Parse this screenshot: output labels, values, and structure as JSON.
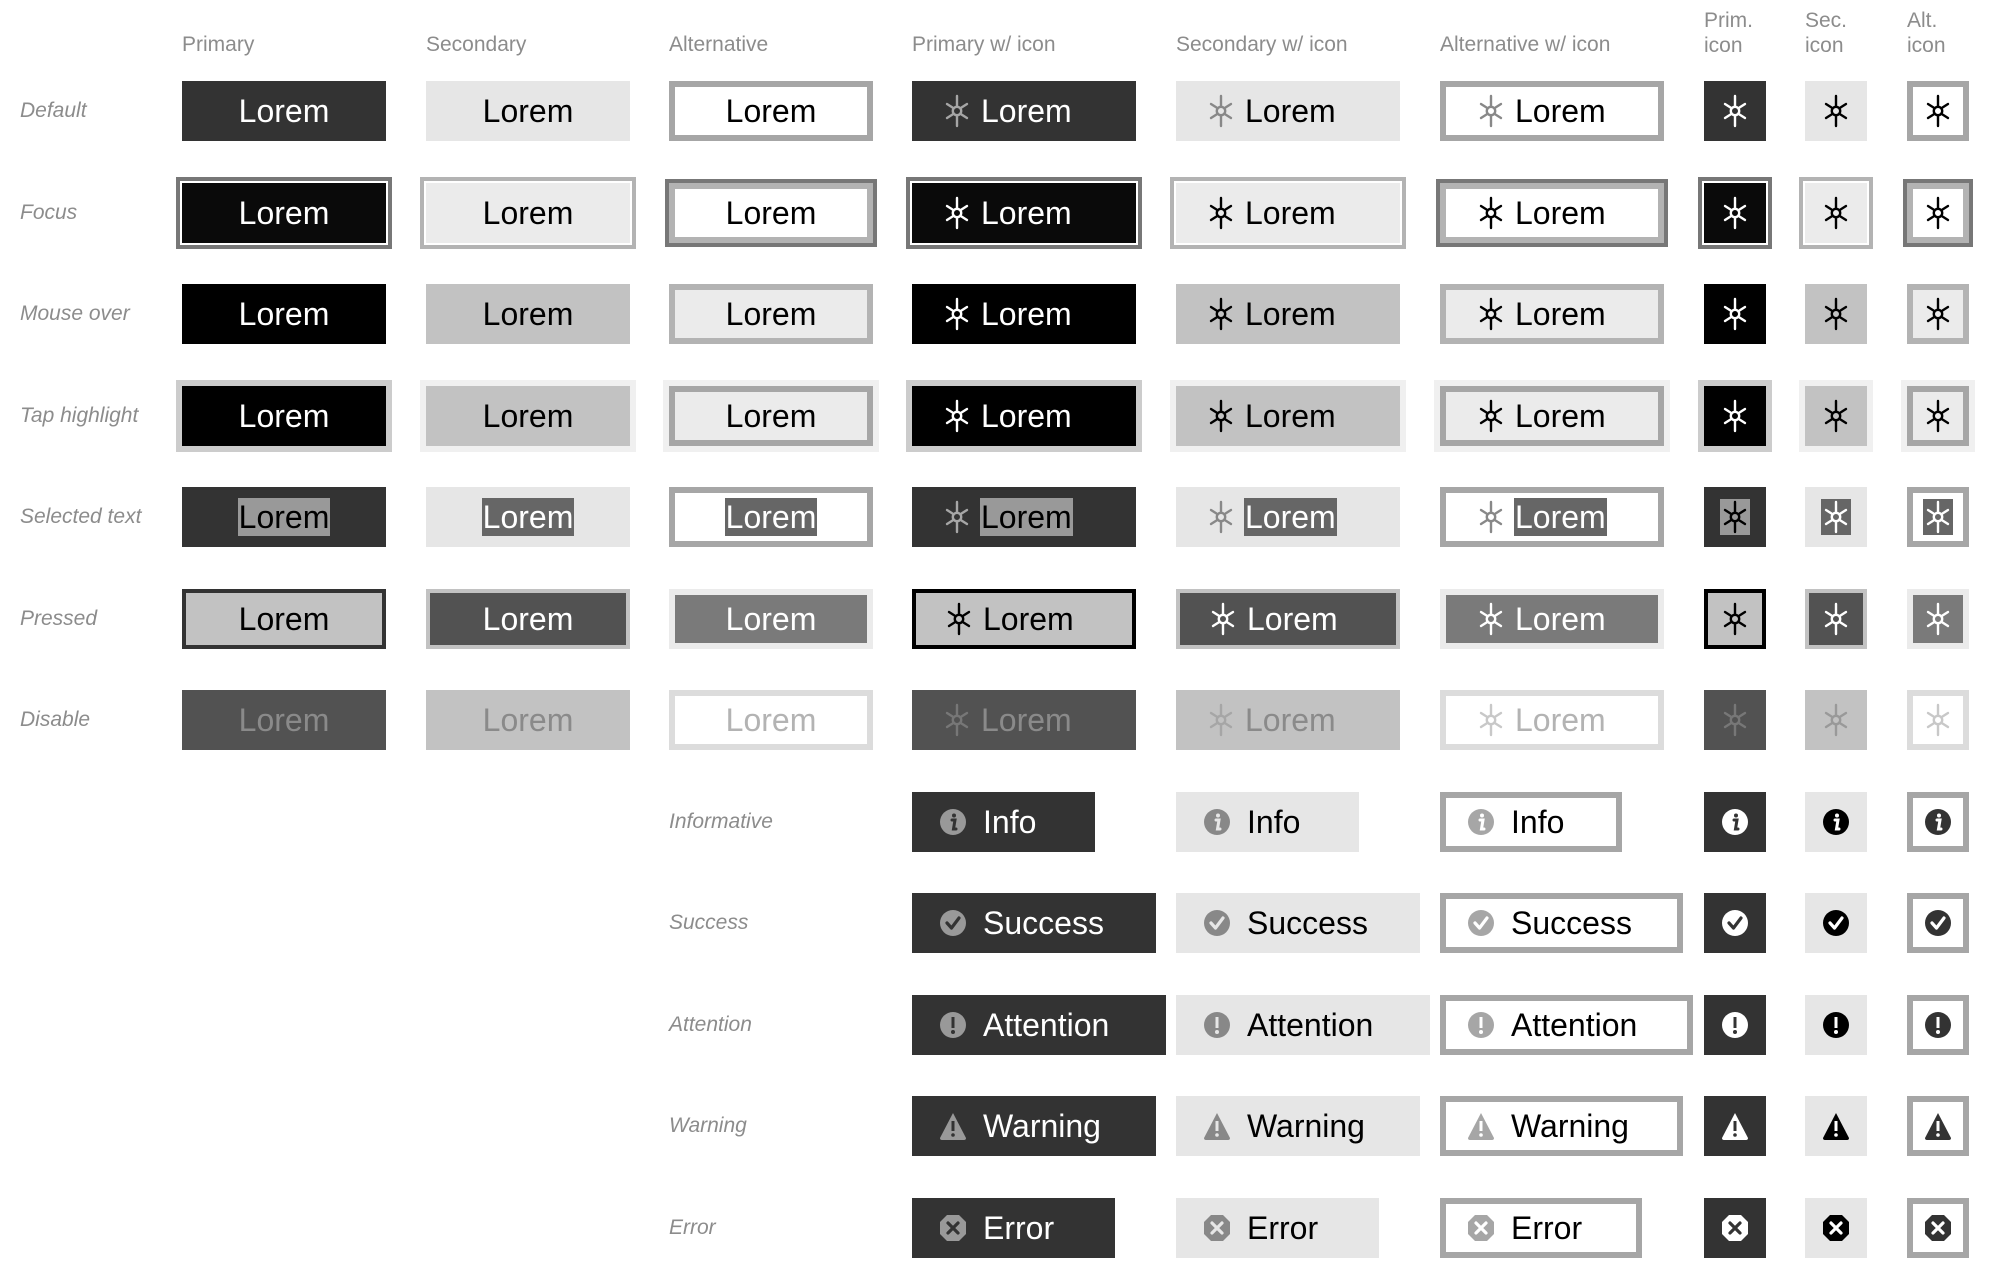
{
  "headers": [
    "Primary",
    "Secondary",
    "Alternative",
    "Primary w/ icon",
    "Secondary w/ icon",
    "Alternative w/ icon",
    "Prim.\nicon",
    "Sec.\nicon",
    "Alt.\nicon"
  ],
  "button_label": "Lorem",
  "button_icon": "sun-gear-icon",
  "states": [
    {
      "key": "default",
      "label": "Default"
    },
    {
      "key": "focus",
      "label": "Focus"
    },
    {
      "key": "mouseover",
      "label": "Mouse over"
    },
    {
      "key": "tap",
      "label": "Tap highlight"
    },
    {
      "key": "selected",
      "label": "Selected text"
    },
    {
      "key": "pressed",
      "label": "Pressed"
    },
    {
      "key": "disable",
      "label": "Disable"
    }
  ],
  "statuses": [
    {
      "key": "info",
      "label": "Informative",
      "text": "Info",
      "icon": "info-icon"
    },
    {
      "key": "success",
      "label": "Success",
      "text": "Success",
      "icon": "check-circle-icon"
    },
    {
      "key": "attention",
      "label": "Attention",
      "text": "Attention",
      "icon": "exclamation-circle-icon"
    },
    {
      "key": "warning",
      "label": "Warning",
      "text": "Warning",
      "icon": "warning-triangle-icon"
    },
    {
      "key": "error",
      "label": "Error",
      "text": "Error",
      "icon": "error-octagon-icon"
    }
  ]
}
